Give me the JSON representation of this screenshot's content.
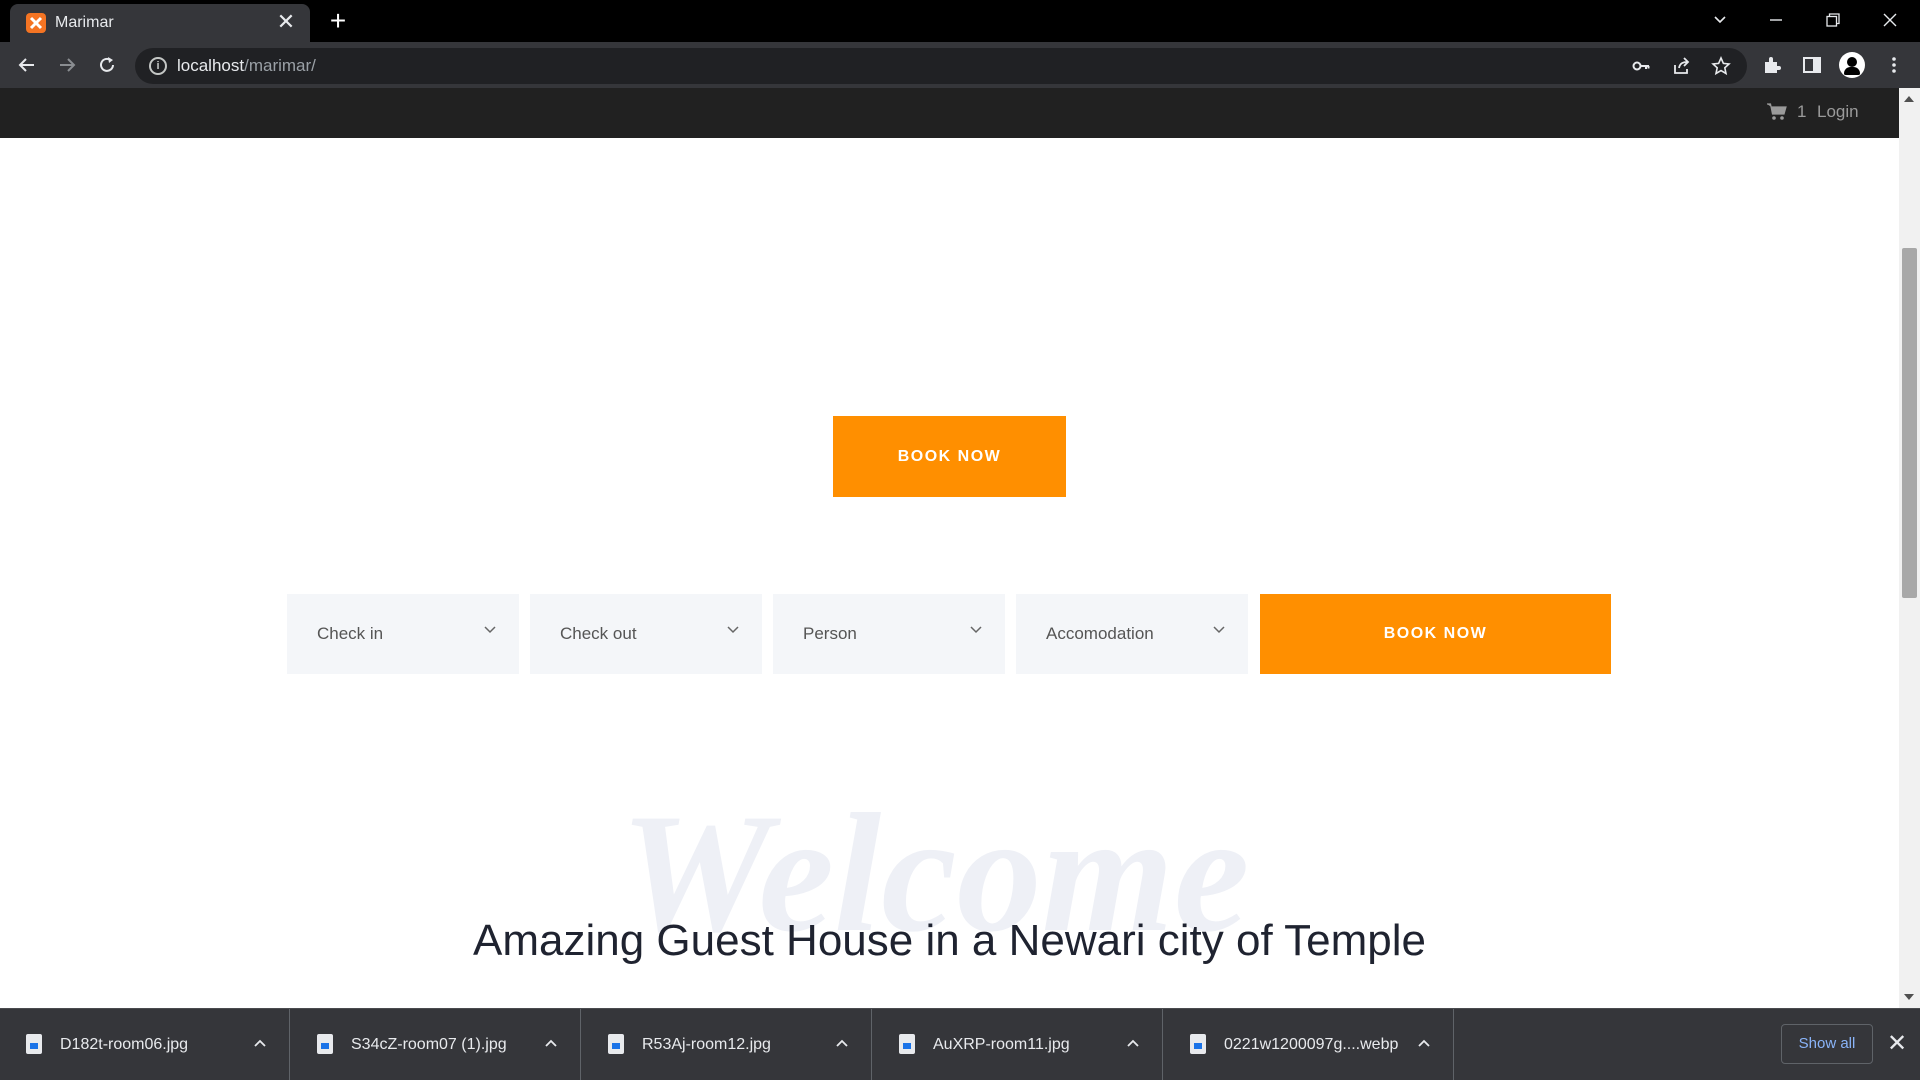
{
  "browser": {
    "tab_title": "Marimar",
    "tab_close": "✕",
    "new_tab": "+",
    "url_host": "localhost",
    "url_path": "/marimar/"
  },
  "site": {
    "nav": {
      "cart_count": "1",
      "login_label": "Login"
    },
    "hero_button": "BOOK NOW",
    "booking": {
      "fields": [
        {
          "label": "Check in"
        },
        {
          "label": "Check out"
        },
        {
          "label": "Person"
        },
        {
          "label": "Accomodation"
        }
      ],
      "book_button": "BOOK NOW"
    },
    "welcome_watermark": "Welcome",
    "headline": "Amazing Guest House in a Newari city of Temple"
  },
  "downloads": {
    "items": [
      {
        "name": "D182t-room06.jpg"
      },
      {
        "name": "S34cZ-room07 (1).jpg"
      },
      {
        "name": "R53Aj-room12.jpg"
      },
      {
        "name": "AuXRP-room11.jpg"
      },
      {
        "name": "0221w1200097g....webp"
      }
    ],
    "show_all": "Show all",
    "close": "✕"
  },
  "colors": {
    "accent": "#ff8f00",
    "site_nav_bg": "#212121",
    "field_bg": "#f4f6f9",
    "chrome_bg": "#35363a"
  }
}
